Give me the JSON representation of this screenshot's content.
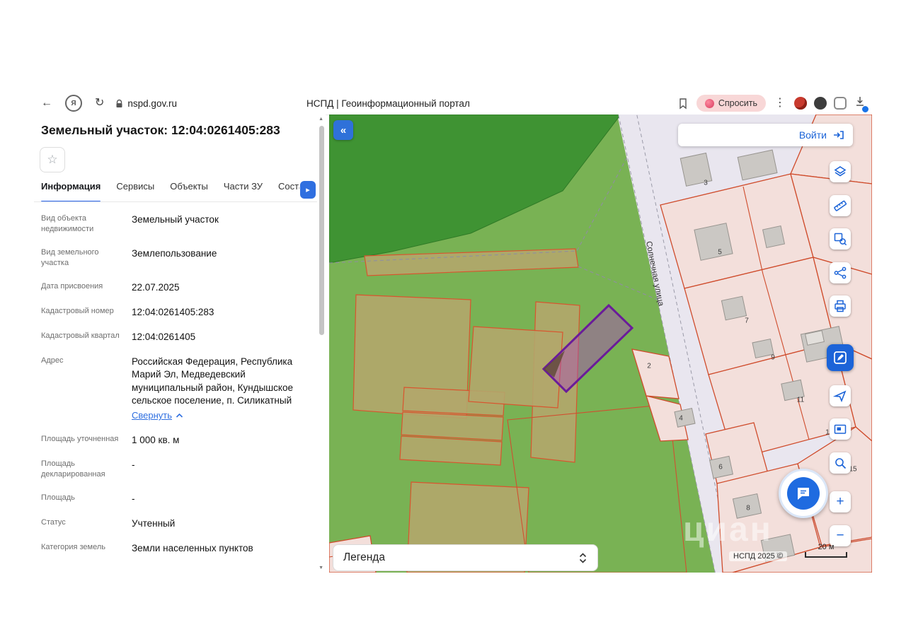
{
  "browser": {
    "url": "nspd.gov.ru",
    "page_title": "НСПД | Геоинформационный портал",
    "ask_label": "Спросить"
  },
  "panel": {
    "title": "Земельный участок: 12:04:0261405:283",
    "tabs": [
      {
        "label": "Информация",
        "active": true
      },
      {
        "label": "Сервисы",
        "active": false
      },
      {
        "label": "Объекты",
        "active": false
      },
      {
        "label": "Части ЗУ",
        "active": false
      },
      {
        "label": "Соста",
        "active": false
      }
    ],
    "rows": [
      {
        "label": "Вид объекта недвижимости",
        "value": "Земельный участок"
      },
      {
        "label": "Вид земельного участка",
        "value": "Землепользование"
      },
      {
        "label": "Дата присвоения",
        "value": "22.07.2025"
      },
      {
        "label": "Кадастровый номер",
        "value": "12:04:0261405:283"
      },
      {
        "label": "Кадастровый квартал",
        "value": "12:04:0261405"
      },
      {
        "label": "Адрес",
        "value": "Российская Федерация, Республика Марий Эл, Медведевский муниципальный район, Кундышское сельское поселение, п. Силикатный",
        "collapse_link": "Свернуть"
      },
      {
        "label": "Площадь уточненная",
        "value": "1 000 кв. м"
      },
      {
        "label": "Площадь декларированная",
        "value": "-"
      },
      {
        "label": "Площадь",
        "value": "-"
      },
      {
        "label": "Статус",
        "value": "Учтенный"
      },
      {
        "label": "Категория земель",
        "value": "Земли населенных пунктов"
      }
    ]
  },
  "map": {
    "login_label": "Войти",
    "legend_label": "Легенда",
    "street_label": "Солнечная улица",
    "attribution": "НСПД 2025 ©",
    "scale_label": "20 м",
    "watermark": "циан",
    "parcel_numbers": [
      "3",
      "5",
      "7",
      "2",
      "9",
      "11",
      "4",
      "1",
      "6",
      "15",
      "8",
      "10"
    ]
  },
  "colors": {
    "accent_blue": "#1c64d8",
    "selection_purple": "#6a1b9a",
    "forest_green": "#3f9333",
    "field_green": "#79b254",
    "parcel_khaki": "#b3a66b",
    "quarter_pink": "#f3dfdb",
    "boundary_red": "#cf4b2b",
    "ask_pink": "#f8d7d7"
  }
}
